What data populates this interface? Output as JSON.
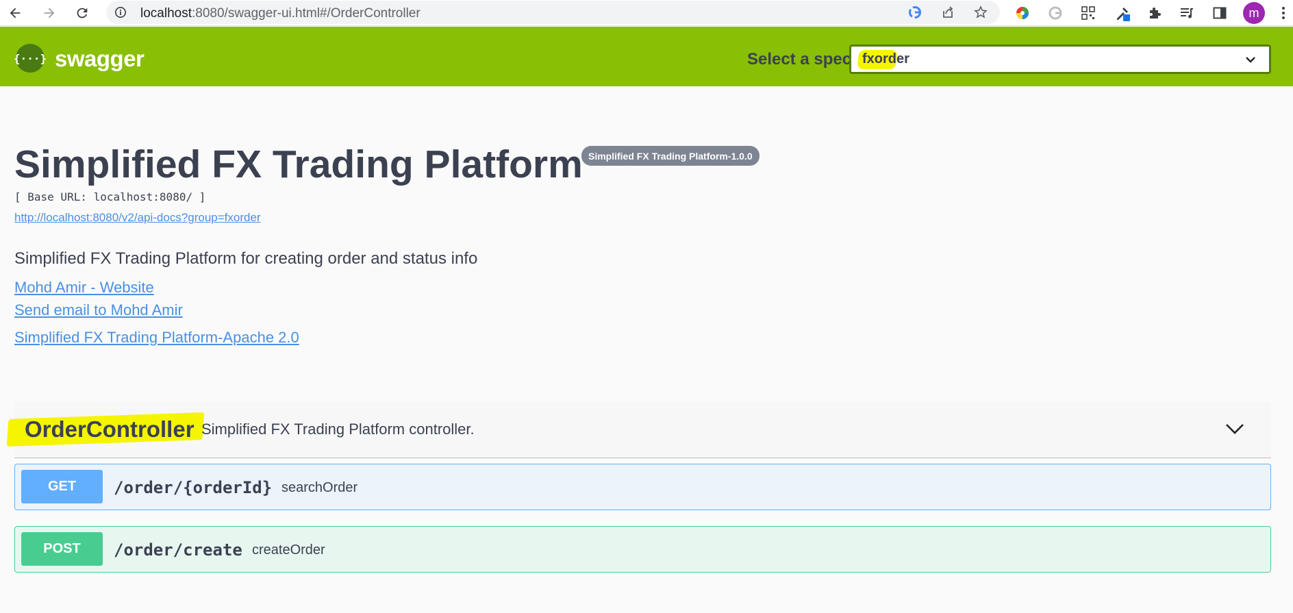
{
  "browser": {
    "url_host": "localhost",
    "url_path": ":8080/swagger-ui.html#/OrderController",
    "avatar_letter": "m"
  },
  "topbar": {
    "logo_symbol": "{···}",
    "logo_text": "swagger",
    "spec_label": "Select a spec",
    "spec_value": "fxorder",
    "highlight_color": "#f5f500",
    "bg_color": "#89bf04"
  },
  "info": {
    "title": "Simplified FX Trading Platform",
    "version": "Simplified FX Trading Platform-1.0.0",
    "base_url": "[ Base URL: localhost:8080/ ]",
    "doc_link": "http://localhost:8080/v2/api-docs?group=fxorder",
    "description": "Simplified FX Trading Platform for creating order and status info",
    "contact_website": "Mohd Amir - Website",
    "contact_email": "Send email to Mohd Amir",
    "license": "Simplified FX Trading Platform-Apache 2.0"
  },
  "tag": {
    "name": "OrderController",
    "description": "Simplified FX Trading Platform controller."
  },
  "operations": [
    {
      "method": "GET",
      "path": "/order/{orderId}",
      "summary": "searchOrder",
      "color": "#61affe"
    },
    {
      "method": "POST",
      "path": "/order/create",
      "summary": "createOrder",
      "color": "#49cc90"
    }
  ]
}
